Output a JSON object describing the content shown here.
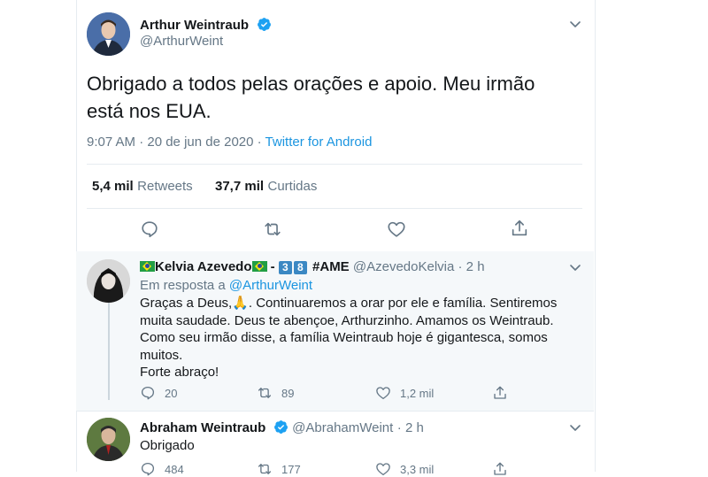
{
  "main_tweet": {
    "author_name": "Arthur Weintraub",
    "author_handle": "@ArthurWeint",
    "text_line1": "Obrigado a todos pelas orações e apoio. Meu irmão",
    "text_line2": "está nos EUA.",
    "time": "9:07 AM · 20 de jun de 2020 · ",
    "source": "Twitter for Android",
    "retweets_count": "5,4 mil",
    "retweets_label": "Retweets",
    "likes_count": "37,7 mil",
    "likes_label": "Curtidas"
  },
  "reply1": {
    "name_text": "Kelvia Azevedo",
    "dash": "-",
    "digits": [
      "3",
      "8"
    ],
    "tag": "#AME",
    "handle": "@AzevedoKelvia",
    "time": "· 2 h",
    "in_reply_to_prefix": "Em resposta a ",
    "in_reply_to_handle": "@ArthurWeint",
    "lines": [
      "Graças a Deus,🙏. Continuaremos a orar por ele e família. Sentiremos",
      "muita saudade. Deus te abençoe, Arthurzinho. Amamos os Weintraub.",
      "Como seu irmão disse, a família Weintraub hoje é gigantesca, somos",
      "muitos.",
      "Forte abraço!"
    ],
    "replies": "20",
    "retweets": "89",
    "likes": "1,2 mil"
  },
  "reply2": {
    "name": "Abraham Weintraub",
    "handle": "@AbrahamWeint",
    "time": "· 2 h",
    "text": "Obrigado",
    "replies": "484",
    "retweets": "177",
    "likes": "3,3 mil"
  },
  "colors": {
    "accent": "#1b95e0",
    "muted": "#657786",
    "verified": "#1da1f2",
    "reply_bg": "#f5f8fa"
  }
}
